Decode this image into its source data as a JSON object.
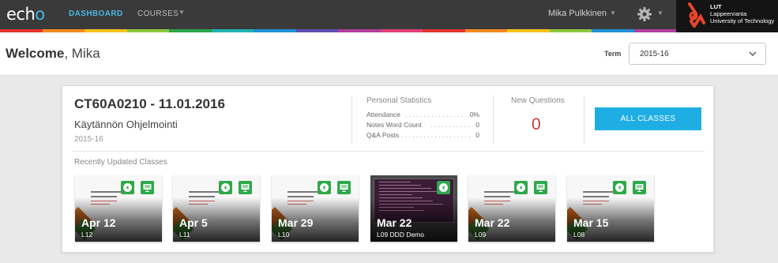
{
  "nav": {
    "logo": "ech",
    "logo_o": "o",
    "dashboard": "DASHBOARD",
    "courses": "COURSES",
    "user_name": "Mika Pulkkinen",
    "brand_lines": [
      "LUT",
      "Lappeenranta",
      "University of Technology"
    ]
  },
  "welcome": {
    "greeting": "Welcome",
    "name": ", Mika"
  },
  "term": {
    "label": "Term",
    "value": "2015-16"
  },
  "course": {
    "code": "CT60A0210 - 11.01.2016",
    "name": "Käytännön Ohjelmointi",
    "term": "2015-16",
    "stats_title": "Personal Statistics",
    "stats": [
      {
        "label": "Attendance",
        "value": "0%"
      },
      {
        "label": "Notes Word Count",
        "value": "0"
      },
      {
        "label": "Q&A Posts",
        "value": "0"
      }
    ],
    "new_questions_title": "New Questions",
    "new_questions_count": "0",
    "all_classes": "ALL CLASSES",
    "recent_title": "Recently Updated Classes"
  },
  "classes": [
    {
      "date": "Apr 12",
      "label": "L12"
    },
    {
      "date": "Apr 5",
      "label": "L11"
    },
    {
      "date": "Mar 29",
      "label": "L10"
    },
    {
      "date": "Mar 22",
      "label": "L09 DDD Demo"
    },
    {
      "date": "Mar 22",
      "label": "L09"
    },
    {
      "date": "Mar 15",
      "label": "L08"
    }
  ],
  "colors": {
    "accent": "#1faee4",
    "question_count": "#c33b3b",
    "icon_green": "#2ea84a",
    "stripe": [
      "#e5352c",
      "#f28b1e",
      "#f6c21b",
      "#8cc63e",
      "#2aa44a",
      "#1fb3b0",
      "#1f8fd6",
      "#5b4fb3",
      "#b23d9c",
      "#e0407a",
      "#e5352c",
      "#f28b1e",
      "#f6c21b",
      "#8cc63e",
      "#1f8fd6",
      "#b23d9c"
    ]
  }
}
